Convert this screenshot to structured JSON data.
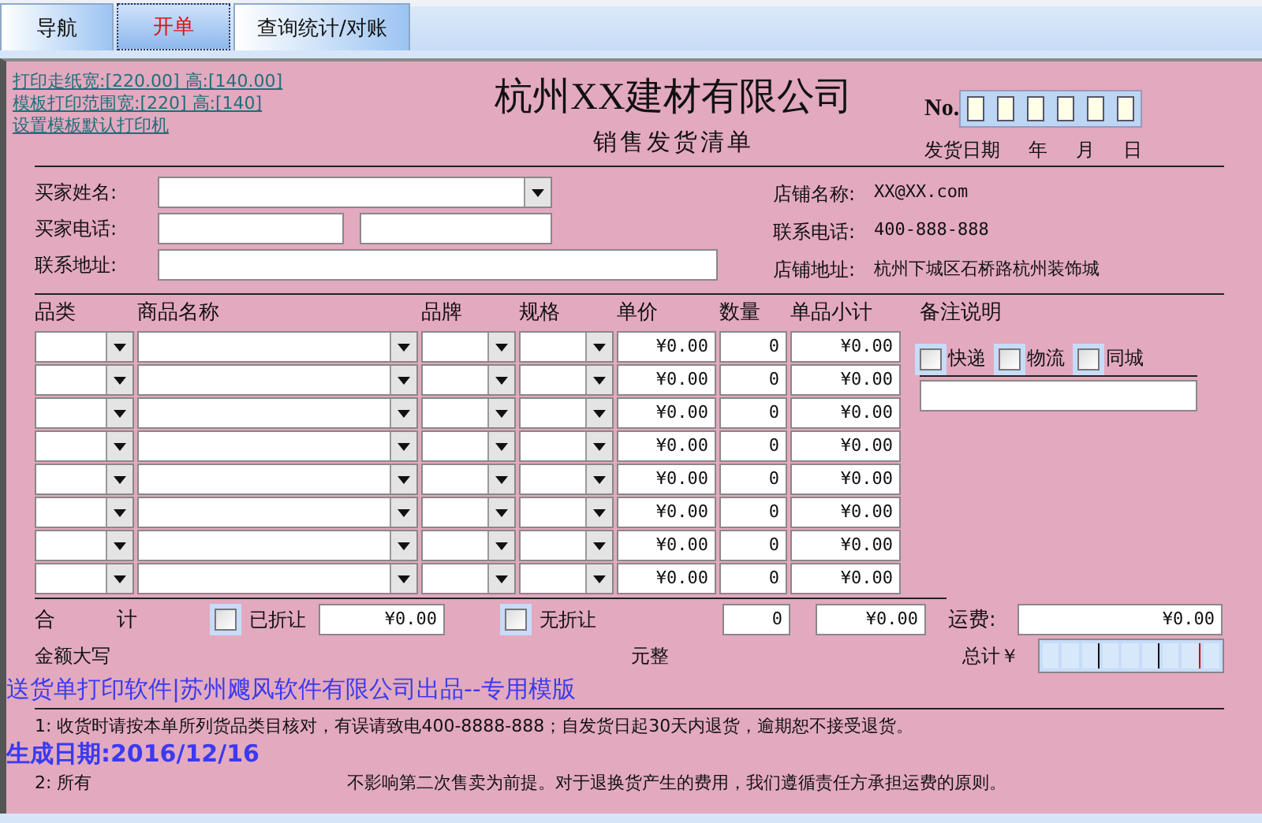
{
  "tabs": [
    {
      "label": "导航",
      "selected": false
    },
    {
      "label": "开单",
      "selected": true
    },
    {
      "label": "查询统计/对账",
      "selected": false
    }
  ],
  "links": [
    "打印走纸宽:[220.00] 高:[140.00]",
    "模板打印范围宽:[220] 高:[140]",
    "设置模板默认打印机"
  ],
  "title": "杭州XX建材有限公司",
  "subtitle": "销售发货清单",
  "no_label": "No.",
  "date_label": "发货日期",
  "date_units": [
    "年",
    "月",
    "日"
  ],
  "buyer": {
    "name_label": "买家姓名:",
    "phone_label": "买家电话:",
    "address_label": "联系地址:"
  },
  "store": [
    {
      "label": "店铺名称:",
      "value": "XX@XX.com"
    },
    {
      "label": "联系电话:",
      "value": "400-888-888"
    },
    {
      "label": "店铺地址:",
      "value": "杭州下城区石桥路杭州装饰城"
    }
  ],
  "columns": [
    "品类",
    "商品名称",
    "品牌",
    "规格",
    "单价",
    "数量",
    "单品小计"
  ],
  "rows": [
    {
      "price": "¥0.00",
      "qty": "0",
      "subtotal": "¥0.00"
    },
    {
      "price": "¥0.00",
      "qty": "0",
      "subtotal": "¥0.00"
    },
    {
      "price": "¥0.00",
      "qty": "0",
      "subtotal": "¥0.00"
    },
    {
      "price": "¥0.00",
      "qty": "0",
      "subtotal": "¥0.00"
    },
    {
      "price": "¥0.00",
      "qty": "0",
      "subtotal": "¥0.00"
    },
    {
      "price": "¥0.00",
      "qty": "0",
      "subtotal": "¥0.00"
    },
    {
      "price": "¥0.00",
      "qty": "0",
      "subtotal": "¥0.00"
    },
    {
      "price": "¥0.00",
      "qty": "0",
      "subtotal": "¥0.00"
    }
  ],
  "remarks": {
    "label": "备注说明",
    "options": [
      {
        "label": "快递",
        "checked": false
      },
      {
        "label": "物流",
        "checked": false
      },
      {
        "label": "同城",
        "checked": false
      }
    ]
  },
  "totals": {
    "label": "合　　　计",
    "discounted": {
      "label": "已折让",
      "checked": false,
      "value": "¥0.00"
    },
    "undiscounted": {
      "label": "无折让",
      "checked": false
    },
    "qty": "0",
    "sum": "¥0.00",
    "freight_label": "运费:",
    "freight": "¥0.00"
  },
  "amount_words_label": "金额大写",
  "yuan_label": "元整",
  "grand_total_label": "总计￥",
  "notes": [
    "1: 收货时请按本单所列货品类目核对，有误请致电400-8888-888；自发货日起30天内退货，逾期恕不接受退货。",
    "2: 所有",
    "不影响第二次售卖为前提。对于退换货产生的费用，我们遵循责任方承担运费的原则。"
  ],
  "stamp": [
    "送货单打印软件|苏州飕风软件有限公司出品--专用模版",
    "生成日期:2016/12/16"
  ]
}
